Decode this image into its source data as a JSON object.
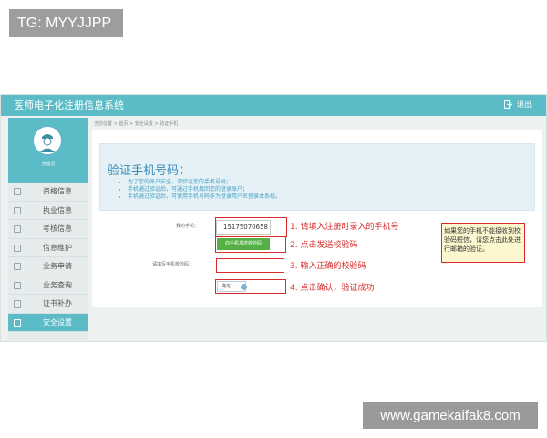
{
  "overlay": {
    "tg_label": "TG: MYYJJPP",
    "watermark": "www.gamekaifak8.com"
  },
  "header": {
    "app_title": "医师电子化注册信息系统",
    "logout_label": "退出",
    "logout_icon": "logout-icon"
  },
  "sidebar": {
    "avatar_icon": "doctor-avatar-icon",
    "username": "管理员",
    "items": [
      {
        "label": "资格信息",
        "icon": "document-icon"
      },
      {
        "label": "执业信息",
        "icon": "headset-icon"
      },
      {
        "label": "考核信息",
        "icon": "clipboard-icon"
      },
      {
        "label": "信息维护",
        "icon": "monitor-icon"
      },
      {
        "label": "业务申请",
        "icon": "edit-icon"
      },
      {
        "label": "业务查询",
        "icon": "search-icon"
      },
      {
        "label": "证书补办",
        "icon": "certificate-icon"
      },
      {
        "label": "安全设置",
        "icon": "user-shield-icon",
        "active": true
      }
    ]
  },
  "breadcrumb": "当前位置 > 首页 > 安全设置 > 验证手机",
  "info": {
    "title": "验证手机号码：",
    "bullets": [
      "为了您的账户安全，请验证您的手机号码；",
      "手机通过验证后，可通过手机找回您的登录账户；",
      "手机通过验证后，可使用手机号码作为登录用户名登录本系统。"
    ]
  },
  "form": {
    "phone_label": "我的手机：",
    "phone_value": "15175070658",
    "send_button": "向手机发送校验码",
    "code_label": "请填写手机校验码：",
    "code_value": "",
    "confirm_label": "确定"
  },
  "steps": [
    "1. 请填入注册时录入的手机号",
    "2. 点击发送校验码",
    "3. 输入正确的校验码",
    "4. 点击确认，验证成功"
  ],
  "note": "如果您的手机不能接收到校验码短信，请您点击此处进行邮箱的验证。",
  "colors": {
    "header": "#5bbcc7",
    "accent_red": "#d92b2b",
    "send_green": "#57b046",
    "info_blue": "#3a8bb4"
  }
}
